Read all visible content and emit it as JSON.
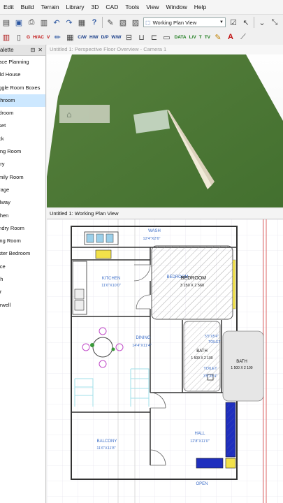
{
  "menu": [
    "Edit",
    "Build",
    "Terrain",
    "Library",
    "3D",
    "CAD",
    "Tools",
    "View",
    "Window",
    "Help"
  ],
  "toolbar1": {
    "view_combo": "Working Plan View"
  },
  "toolbar2": {
    "btns": [
      "G",
      "H/AC",
      "V",
      "C/W",
      "H/W",
      "D/P",
      "W/W",
      "DATA",
      "L/V",
      "T",
      "TV"
    ]
  },
  "palette": {
    "title": "alette",
    "items": [
      "pace Planning",
      "uild House",
      "oggle Room Boxes",
      "athroom",
      "edroom",
      "oset",
      "eck",
      "ning Room",
      "ntry",
      "amily Room",
      "arage",
      "allway",
      "tchen",
      "undry Room",
      "ving Room",
      "aster Bedroom",
      "ffice",
      "rch",
      "air",
      "airwell"
    ],
    "selected_index": 3
  },
  "window_3d": {
    "title": "Untitled 1: Perspective Floor Overview - Camera 1"
  },
  "window_plan": {
    "title": "Untitled 1:  Working Plan View"
  },
  "rooms": {
    "wash": {
      "name": "WASH",
      "dims": "12'4\"X2'6\""
    },
    "kitchen": {
      "name": "KITCHEN",
      "dims": "11'6\"X10'0\""
    },
    "bedroom": {
      "name": "BEDROOM",
      "name2": "BEDROOM",
      "dims": "3 150 X 2 560"
    },
    "dining": {
      "name": "DINING",
      "dims": "14'4\"X11'4\""
    },
    "bath1": {
      "name": "BATH",
      "dims": "1 500 X 2 100",
      "extra": "TOILET",
      "extra_dims": "5'5\"X5'4\""
    },
    "bath2": {
      "name": "BATH",
      "dims": "1 500 X 2 100"
    },
    "toilet": {
      "name": "TOILET",
      "dims": "3'5\"X5'4\""
    },
    "balcony": {
      "name": "BALCONY",
      "dims": "11'6\"X11'8\""
    },
    "hall": {
      "name": "HALL",
      "dims": "12'8\"X11'0\""
    },
    "open": {
      "name": "OPEN"
    }
  },
  "colors": {
    "accent": "#3c6ec8",
    "selection": "#cde8ff",
    "terrain": "#4d7a36"
  }
}
